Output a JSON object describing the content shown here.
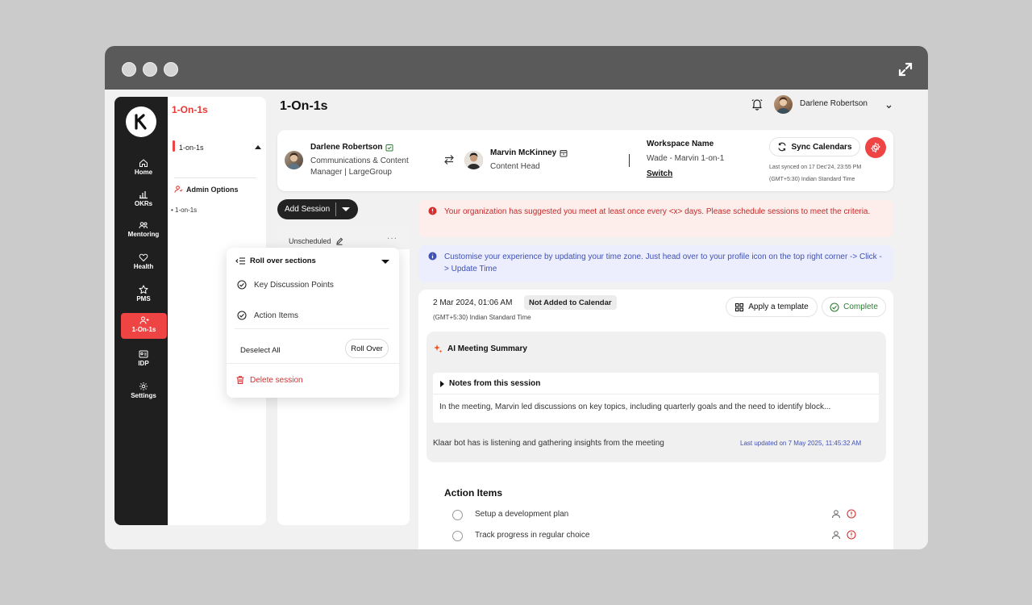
{
  "sidebar": {
    "logo_letter": "K",
    "items": [
      {
        "label": "Home",
        "icon": "home-icon"
      },
      {
        "label": "OKRs",
        "icon": "bar-chart-icon"
      },
      {
        "label": "Mentoring",
        "icon": "users-icon"
      },
      {
        "label": "Health",
        "icon": "heart-icon"
      },
      {
        "label": "PMS",
        "icon": "star-icon"
      },
      {
        "label": "1-On-1s",
        "icon": "one-on-one-icon"
      },
      {
        "label": "IDP",
        "icon": "id-card-icon"
      },
      {
        "label": "Settings",
        "icon": "gear-icon"
      }
    ],
    "active_index": 5
  },
  "subnav": {
    "title": "1-On-1s",
    "item": "1-on-1s",
    "admin_label": "Admin Options",
    "sub_item": "1-on-1s"
  },
  "header": {
    "title": "1-On-1s",
    "user_name": "Darlene Robertson"
  },
  "participants": {
    "first": {
      "name": "Darlene Robertson",
      "role_line1": "Communications & Content",
      "role_line2": "Manager | LargeGroup"
    },
    "second": {
      "name": "Marvin McKinney",
      "role": "Content Head"
    },
    "workspace_label": "Workspace Name",
    "workspace_value": "Wade - Marvin 1-on-1",
    "switch_label": "Switch",
    "sync_label": "Sync Calendars",
    "last_synced": "Last synced on 17 Dec'24, 23:55 PM",
    "timezone": "(GMT+5:30) Indian Standard Time"
  },
  "sessions": {
    "add_label": "Add Session",
    "group_label": "Unscheduled",
    "dots": "···"
  },
  "menu": {
    "rollover_header": "Roll over sections",
    "options": [
      "Key Discussion Points",
      "Action Items"
    ],
    "deselect_label": "Deselect All",
    "rollover_button": "Roll Over",
    "delete_label": "Delete session"
  },
  "alerts": {
    "warning": "Your organization has suggested you meet at least once every <x> days. Please schedule sessions to meet the criteria.",
    "info": "Customise your experience by updating your time zone. Just head over to your profile icon on the top right corner -> Click -> Update Time"
  },
  "detail": {
    "date": "2 Mar 2024, 01:06 AM",
    "calendar_status": "Not Added to Calendar",
    "timezone": "(GMT+5:30) Indian Standard Time",
    "template_label": "Apply a template",
    "complete_label": "Complete",
    "ai_title": "AI Meeting Summary",
    "notes_title": "Notes from this session",
    "notes_text": "In the meeting, Marvin led discussions on key topics, including quarterly goals and the need to identify block...",
    "listening_text": "Klaar bot has is listening and gathering insights from the meeting",
    "last_updated": "Last updated on 7 May 2025, 11:45:32 AM",
    "action_heading": "Action Items",
    "action_items": [
      "Setup a development plan",
      "Track progress in regular choice"
    ]
  },
  "colors": {
    "accent": "#ef4444",
    "rail": "#1f1f1f",
    "info": "#3f51b5",
    "warning": "#c62828",
    "success": "#2e7d32"
  }
}
